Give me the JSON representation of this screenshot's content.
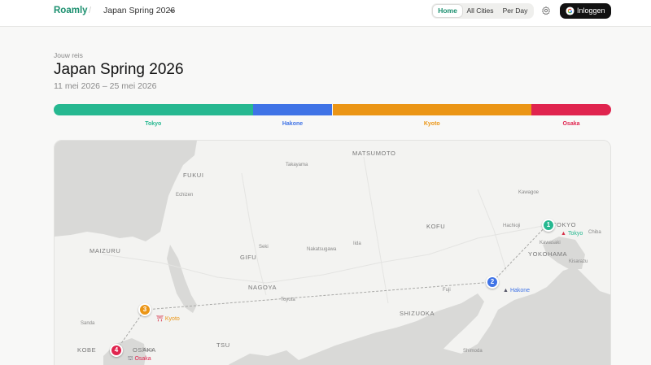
{
  "header": {
    "brand": "Roamly",
    "separator": "/",
    "trip_selector": "Japan Spring 2026",
    "nav": [
      {
        "label": "Home",
        "active": true
      },
      {
        "label": "All Cities",
        "active": false
      },
      {
        "label": "Per Day",
        "active": false
      }
    ],
    "login_label": "Inloggen"
  },
  "trip": {
    "eyebrow": "Jouw reis",
    "title": "Japan Spring 2026",
    "dates": "11 mei 2026 – 25 mei 2026"
  },
  "timeline": {
    "segments": [
      {
        "city": "Tokyo",
        "color": "#26b890",
        "share": 0.357
      },
      {
        "city": "Hakone",
        "color": "#3f73e6",
        "share": 0.143
      },
      {
        "city": "Kyoto",
        "color": "#eb9515",
        "share": 0.357
      },
      {
        "city": "Osaka",
        "color": "#e0244e",
        "share": 0.143
      }
    ]
  },
  "map": {
    "region_labels": [
      "MATSUMOTO",
      "FUKUI",
      "KOFU",
      "MAIZURU",
      "GIFU",
      "NAGOYA",
      "SHIZUOKA",
      "YOKOHAMA",
      "TSU",
      "KOBE",
      "OSAKA",
      "TOKYO"
    ],
    "place_labels": [
      "Takayama",
      "Echizen",
      "Kawagoe",
      "Hachioji",
      "Chiba",
      "Kawasaki",
      "Kisarazu",
      "Seki",
      "Nakatsugawa",
      "Iida",
      "Fuji",
      "Toyota",
      "Sanda",
      "Nara",
      "Shimoda"
    ],
    "stops": [
      {
        "number": "1",
        "city": "Tokyo",
        "icon": "tokyo-tower-icon",
        "color": "#26b890"
      },
      {
        "number": "2",
        "city": "Hakone",
        "icon": "mountain-icon",
        "color": "#3f73e6"
      },
      {
        "number": "3",
        "city": "Kyoto",
        "icon": "torii-gate-icon",
        "color": "#eb9515"
      },
      {
        "number": "4",
        "city": "Osaka",
        "icon": "osaka-castle-icon",
        "color": "#e0244e"
      }
    ]
  }
}
